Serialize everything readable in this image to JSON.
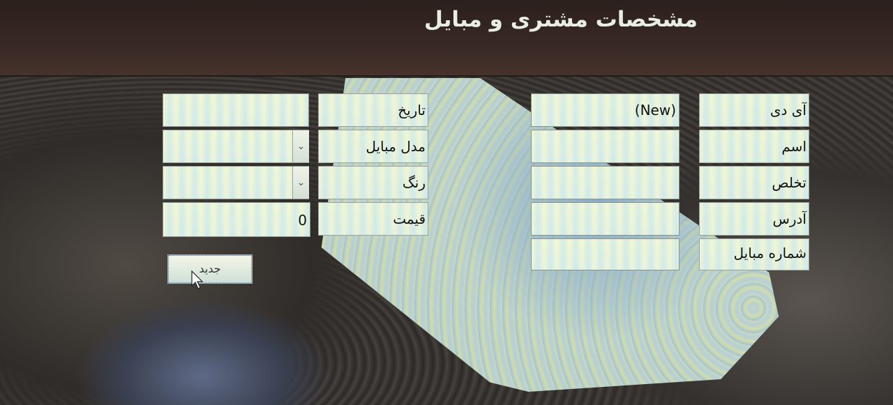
{
  "header": {
    "title": "مشخصات مشتری و مبایل"
  },
  "customer": {
    "id_label": "آی دی",
    "id_value": "(New)",
    "name_label": "اسم",
    "name_value": "",
    "surname_label": "تخلص",
    "surname_value": "",
    "address_label": "آدرس",
    "address_value": "",
    "phone_label": "شماره مبایل",
    "phone_value": ""
  },
  "mobile": {
    "date_label": "تاریخ",
    "date_value": "",
    "model_label": "مدل مبایل",
    "model_value": "",
    "color_label": "رنگ",
    "color_value": "",
    "price_label": "قیمت",
    "price_value": "0"
  },
  "actions": {
    "new_label": "جدید"
  },
  "icons": {
    "dropdown": "chevron-down-icon",
    "cursor": "mouse-pointer-icon"
  }
}
